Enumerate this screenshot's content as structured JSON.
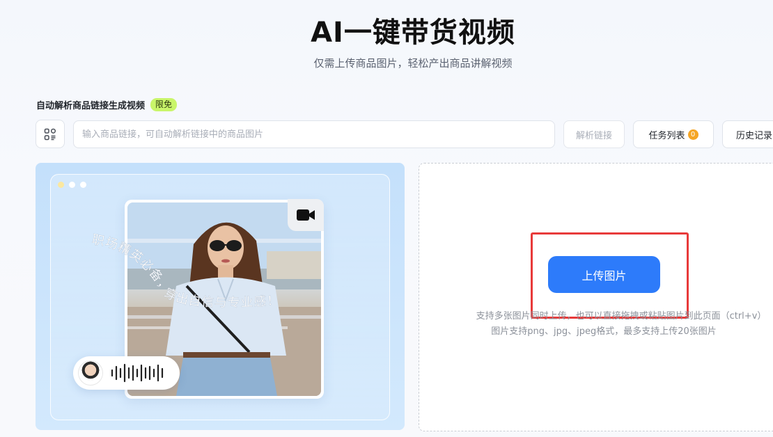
{
  "header": {
    "title": "AI一键带货视频",
    "subtitle": "仅需上传商品图片，轻松产出商品讲解视频"
  },
  "link_section": {
    "label": "自动解析商品链接生成视频",
    "badge": "限免",
    "input_placeholder": "输入商品链接，可自动解析链接中的商品图片",
    "input_value": "",
    "parse_button": "解析链接",
    "tasks_button": "任务列表",
    "tasks_count": "0",
    "history_button": "历史记录"
  },
  "preview": {
    "caption": "职场精英必备，穿出自信与专业感！",
    "icons": [
      "scan-icon",
      "video-camera-icon",
      "voice-wave-icon"
    ]
  },
  "upload": {
    "button_label": "上传图片",
    "hint_line1": "支持多张图片同时上传，也可以直接拖拽或粘贴图片到此页面（ctrl+v）",
    "hint_line2": "图片支持png、jpg、jpeg格式，最多支持上传20张图片"
  },
  "colors": {
    "primary": "#2d7bfa",
    "badge_free": "#c9f56a",
    "count_badge": "#f5a524",
    "highlight_box": "#e83a3a",
    "preview_bg": "#c4e0fb"
  }
}
